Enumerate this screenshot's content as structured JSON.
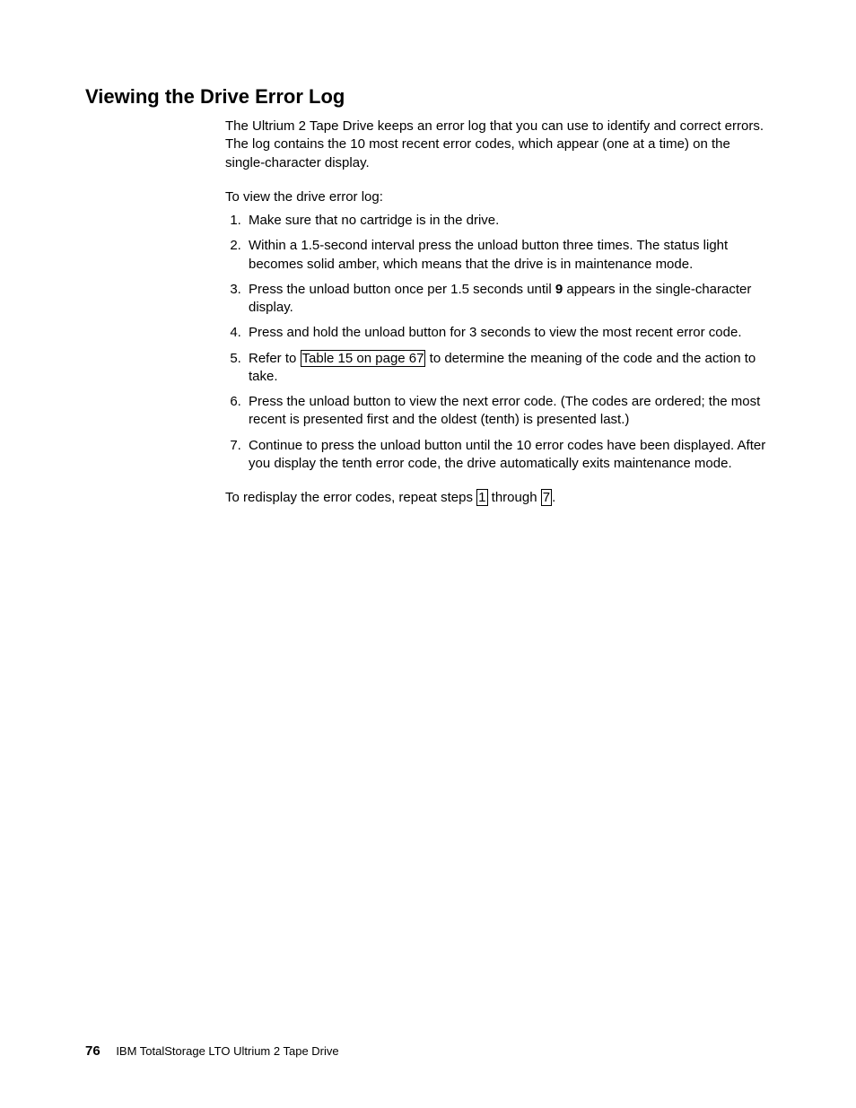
{
  "heading": "Viewing the Drive Error Log",
  "intro": "The Ultrium 2 Tape Drive keeps an error log that you can use to identify and correct errors. The log contains the 10 most recent error codes, which appear (one at a time) on the single-character display.",
  "lead_in": "To view the drive error log:",
  "steps": {
    "s1": "Make sure that no cartridge is in the drive.",
    "s2": "Within a 1.5-second interval press the unload button three times. The status light becomes solid amber, which means that the drive is in maintenance mode.",
    "s3_a": "Press the unload button once per 1.5 seconds until ",
    "s3_bold": "9",
    "s3_b": " appears in the single-character display.",
    "s4": "Press and hold the unload button for 3 seconds to view the most recent error code.",
    "s5_a": "Refer to ",
    "s5_link": "Table 15 on page 67",
    "s5_b": " to determine the meaning of the code and the action to take.",
    "s6": "Press the unload button to view the next error code. (The codes are ordered; the most recent is presented first and the oldest (tenth) is presented last.)",
    "s7": "Continue to press the unload button until the 10 error codes have been displayed. After you display the tenth error code, the drive automatically exits maintenance mode."
  },
  "closing": {
    "a": "To redisplay the error codes, repeat steps ",
    "link1": "1",
    "mid": " through ",
    "link2": "7",
    "end": "."
  },
  "footer": {
    "page_number": "76",
    "doc_title": "IBM TotalStorage LTO Ultrium 2 Tape Drive"
  }
}
